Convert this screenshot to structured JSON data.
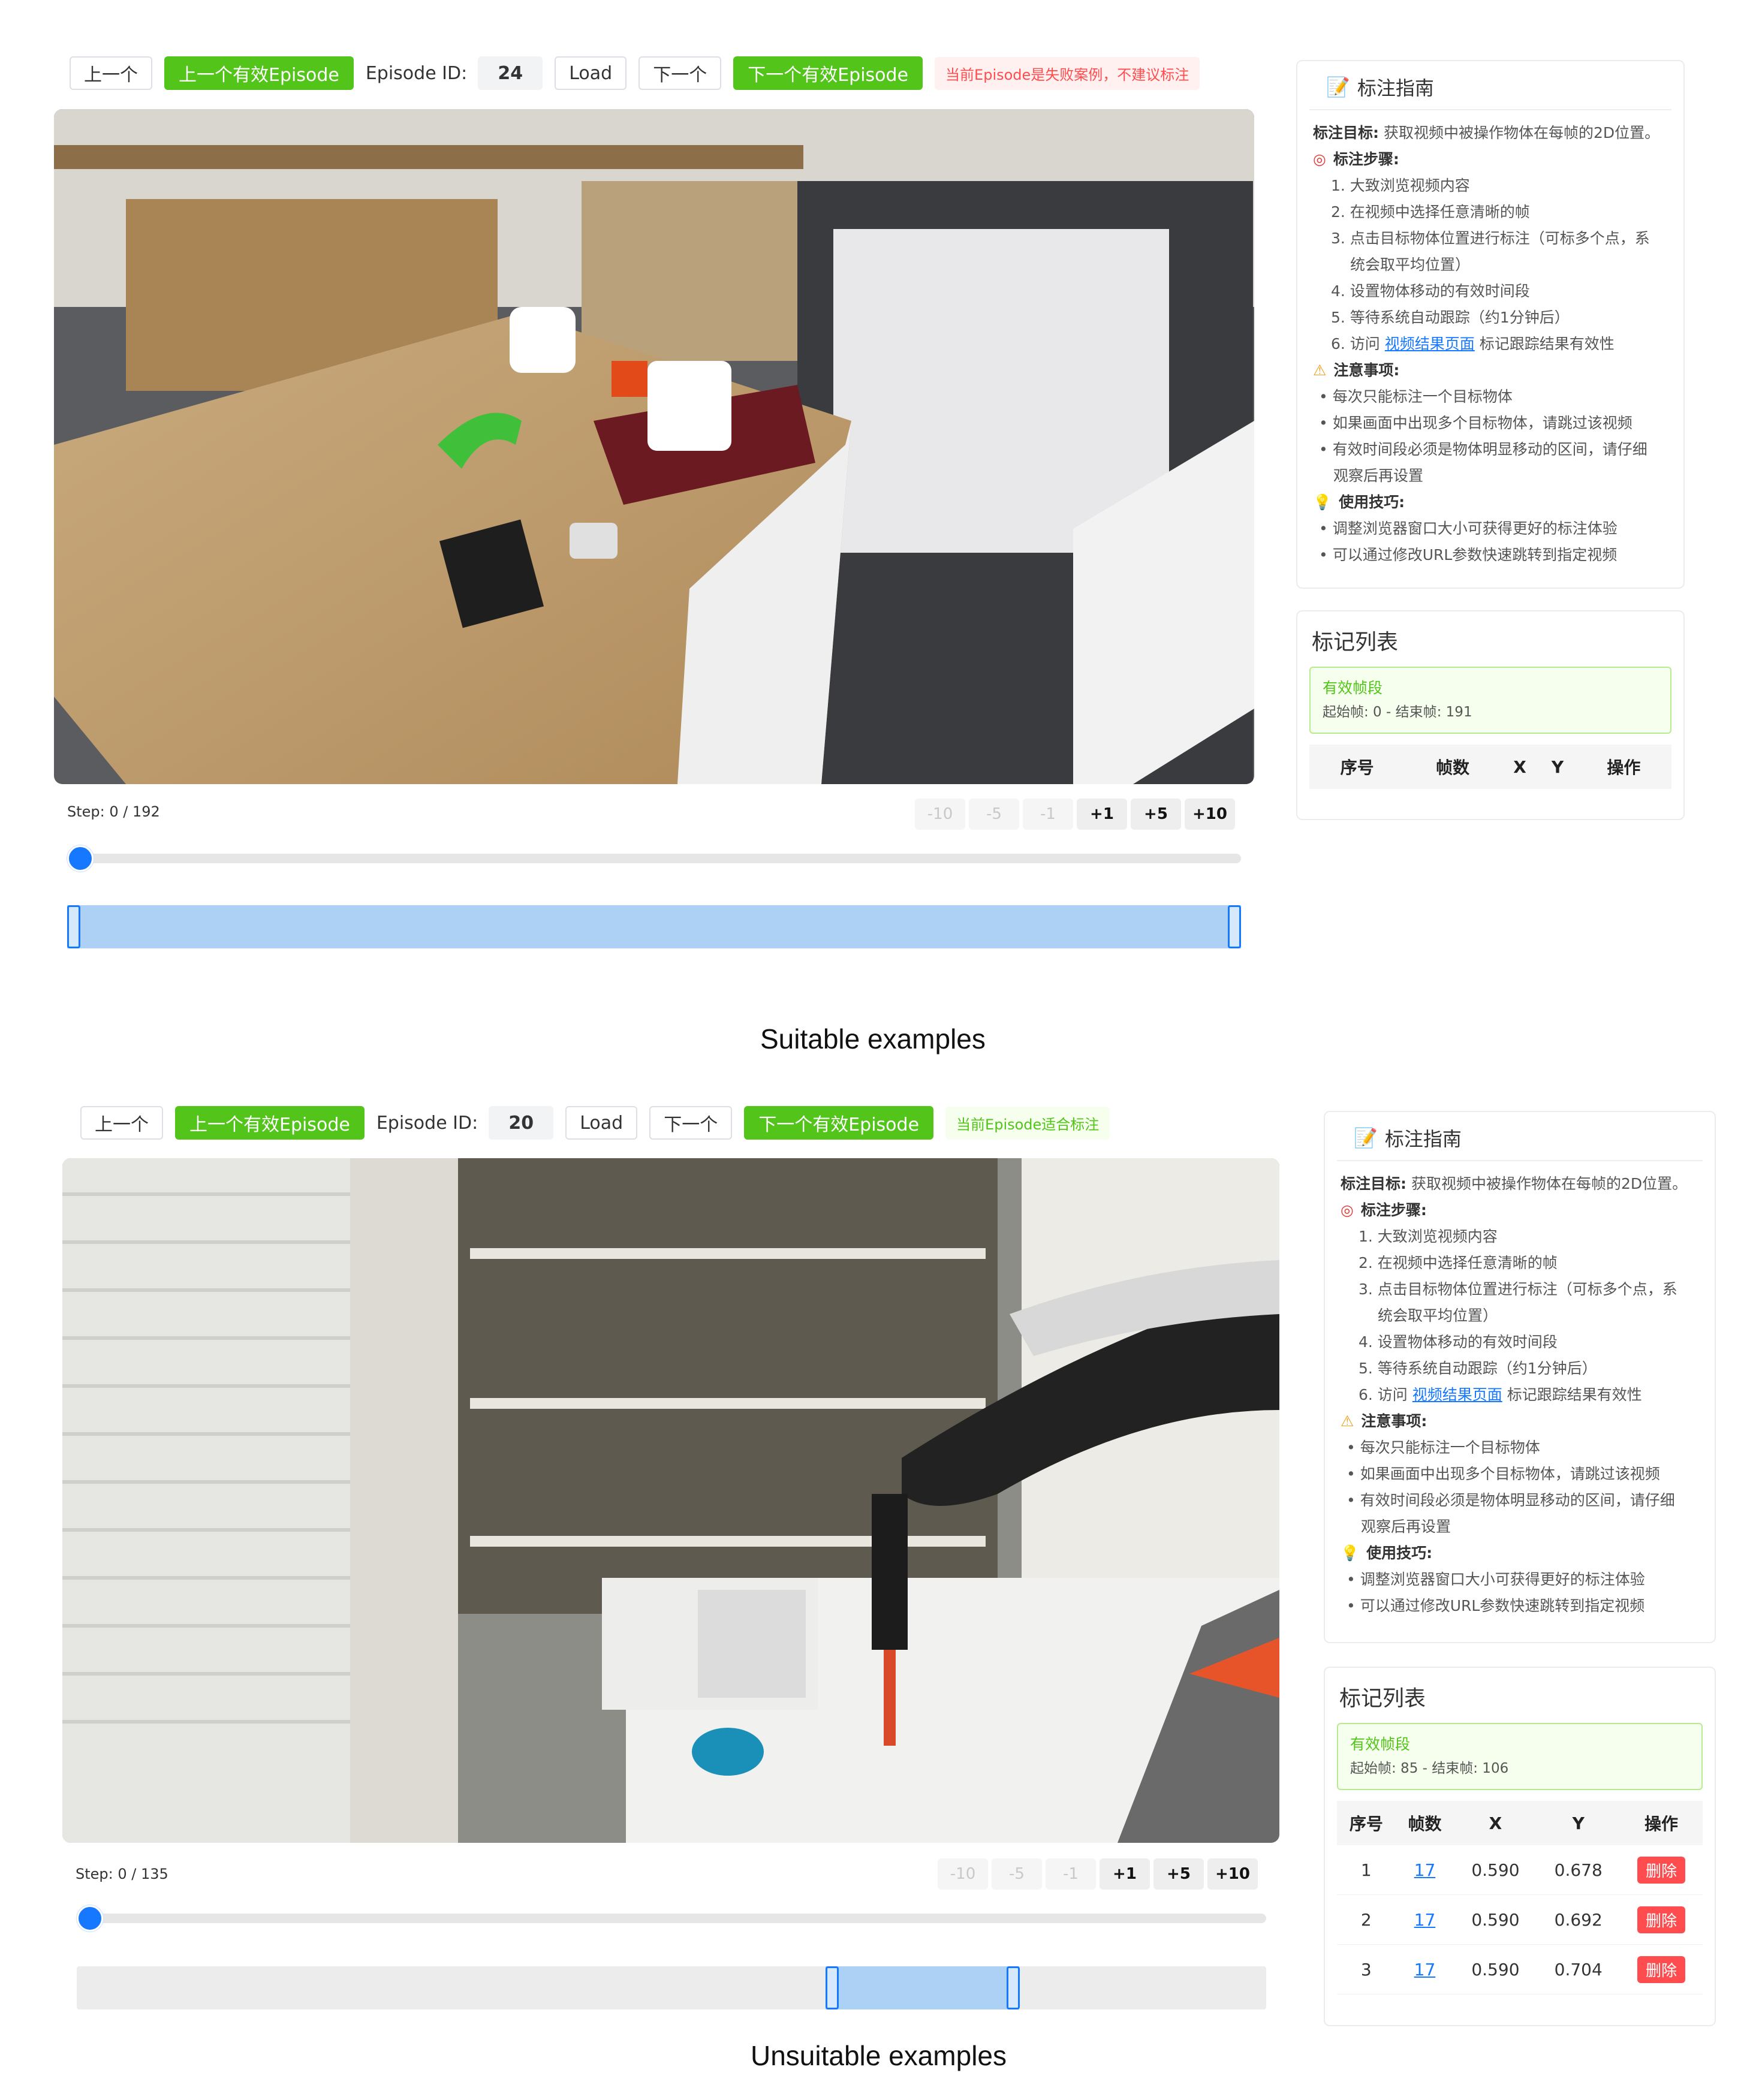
{
  "top": {
    "toolbar": {
      "prev": "上一个",
      "prev_valid": "上一个有效Episode",
      "episode_label": "Episode ID:",
      "episode_id": "24",
      "load": "Load",
      "next": "下一个",
      "next_valid": "下一个有效Episode",
      "notice": "当前Episode是失败案例，不建议标注"
    },
    "step_text": "Step: 0 / 192",
    "step_buttons": [
      "-10",
      "-5",
      "-1",
      "+1",
      "+5",
      "+10"
    ],
    "progress": 0,
    "range": {
      "start": 0,
      "end": 191,
      "total": 192
    },
    "guide": {
      "title": "标注指南",
      "goal_label": "标注目标:",
      "goal_text": "获取视频中被操作物体在每帧的2D位置。",
      "steps_label": "标注步骤:",
      "steps": [
        "1. 大致浏览视频内容",
        "2. 在视频中选择任意清晰的帧",
        "3. 点击目标物体位置进行标注（可标多个点，系",
        "统会取平均位置）",
        "4. 设置物体移动的有效时间段",
        "5. 等待系统自动跟踪（约1分钟后）"
      ],
      "step6_prefix": "6. 访问",
      "step6_link": "视频结果页面",
      "step6_suffix": "标记跟踪结果有效性",
      "notes_label": "注意事项:",
      "notes": [
        "每次只能标注一个目标物体",
        "如果画面中出现多个目标物体，请跳过该视频",
        "有效时间段必须是物体明显移动的区间，请仔细",
        "观察后再设置"
      ],
      "tips_label": "使用技巧:",
      "tips": [
        "调整浏览器窗口大小可获得更好的标注体验",
        "可以通过修改URL参数快速跳转到指定视频"
      ]
    },
    "marks": {
      "title": "标记列表",
      "valid_title": "有效帧段",
      "valid_range": "起始帧: 0 - 结束帧: 191",
      "headers": [
        "序号",
        "帧数",
        "X",
        "Y",
        "操作"
      ],
      "rows": []
    }
  },
  "caption_top": "Suitable examples",
  "bottom": {
    "toolbar": {
      "prev": "上一个",
      "prev_valid": "上一个有效Episode",
      "episode_label": "Episode ID:",
      "episode_id": "20",
      "load": "Load",
      "next": "下一个",
      "next_valid": "下一个有效Episode",
      "notice": "当前Episode适合标注"
    },
    "step_text": "Step: 0 / 135",
    "step_buttons": [
      "-10",
      "-5",
      "-1",
      "+1",
      "+5",
      "+10"
    ],
    "progress": 0,
    "range": {
      "start": 85,
      "end": 106,
      "total": 135
    },
    "guide": {
      "title": "标注指南",
      "goal_label": "标注目标:",
      "goal_text": "获取视频中被操作物体在每帧的2D位置。",
      "steps_label": "标注步骤:",
      "steps": [
        "1. 大致浏览视频内容",
        "2. 在视频中选择任意清晰的帧",
        "3. 点击目标物体位置进行标注（可标多个点，系",
        "统会取平均位置）",
        "4. 设置物体移动的有效时间段",
        "5. 等待系统自动跟踪（约1分钟后）"
      ],
      "step6_prefix": "6. 访问",
      "step6_link": "视频结果页面",
      "step6_suffix": "标记跟踪结果有效性",
      "notes_label": "注意事项:",
      "notes": [
        "每次只能标注一个目标物体",
        "如果画面中出现多个目标物体，请跳过该视频",
        "有效时间段必须是物体明显移动的区间，请仔细",
        "观察后再设置"
      ],
      "tips_label": "使用技巧:",
      "tips": [
        "调整浏览器窗口大小可获得更好的标注体验",
        "可以通过修改URL参数快速跳转到指定视频"
      ]
    },
    "marks": {
      "title": "标记列表",
      "valid_title": "有效帧段",
      "valid_range": "起始帧: 85 - 结束帧: 106",
      "headers": [
        "序号",
        "帧数",
        "X",
        "Y",
        "操作"
      ],
      "rows": [
        {
          "idx": "1",
          "frame": "17",
          "x": "0.590",
          "y": "0.678",
          "action": "删除"
        },
        {
          "idx": "2",
          "frame": "17",
          "x": "0.590",
          "y": "0.692",
          "action": "删除"
        },
        {
          "idx": "3",
          "frame": "17",
          "x": "0.590",
          "y": "0.704",
          "action": "删除"
        }
      ]
    }
  },
  "caption_bottom": "Unsuitable examples"
}
